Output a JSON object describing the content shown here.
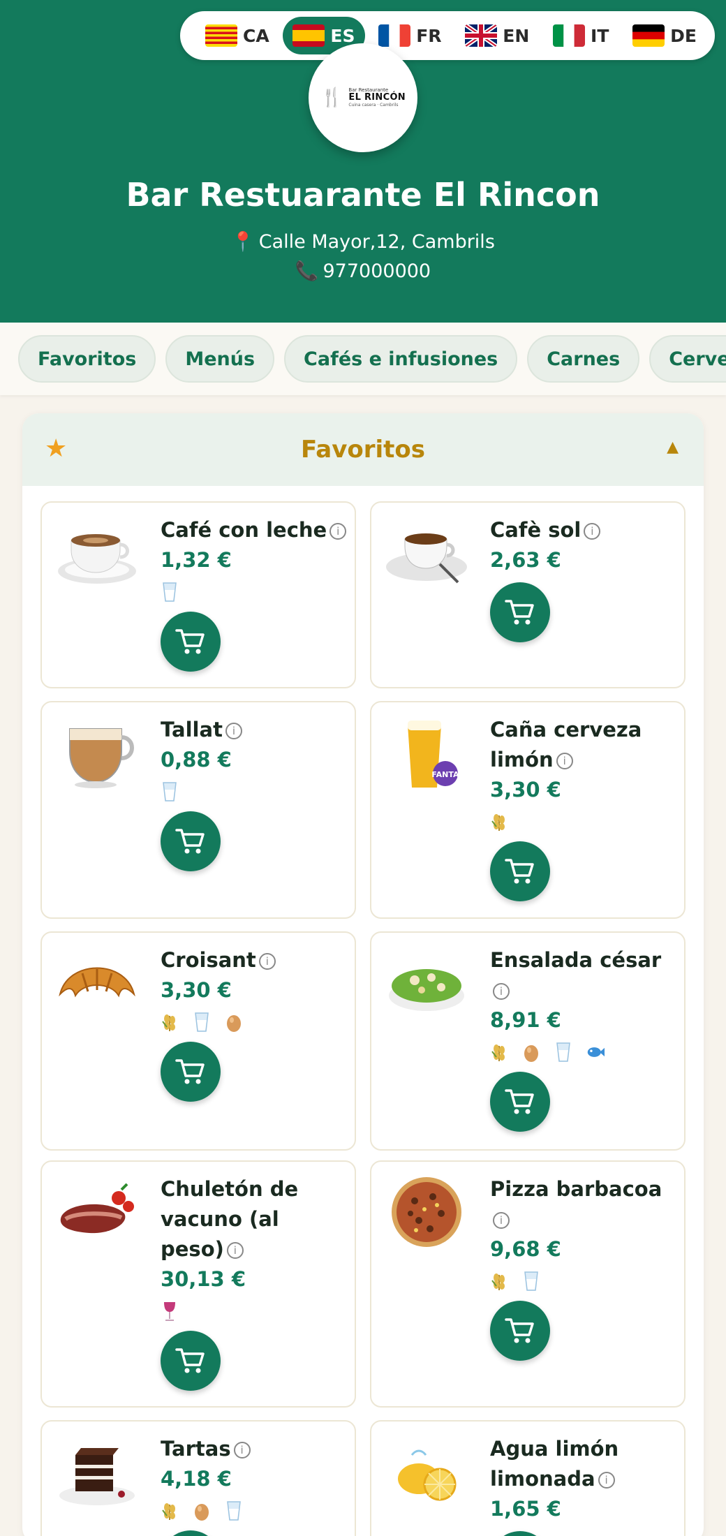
{
  "languages": [
    {
      "code": "CA",
      "flag": "ca-flag-icon",
      "active": false
    },
    {
      "code": "ES",
      "flag": "es-flag-icon",
      "active": true
    },
    {
      "code": "FR",
      "flag": "fr-flag-icon",
      "active": false
    },
    {
      "code": "EN",
      "flag": "uk-flag-icon",
      "active": false
    },
    {
      "code": "IT",
      "flag": "it-flag-icon",
      "active": false
    },
    {
      "code": "DE",
      "flag": "de-flag-icon",
      "active": false
    }
  ],
  "logo": {
    "small": "Bar Restaurante",
    "main": "EL RINCÓN",
    "sub": "Cuina casera · Cambrils"
  },
  "restaurant": {
    "name": "Bar Restuarante El Rincon",
    "address": "Calle Mayor,12, Cambrils",
    "phone": "977000000"
  },
  "categories": [
    "Favoritos",
    "Menús",
    "Cafés e infusiones",
    "Carnes",
    "Cervezas"
  ],
  "section": {
    "title": "Favoritos",
    "star_icon": "star-icon",
    "toggle_icon": "caret-up-icon"
  },
  "products": [
    {
      "name": "Café con leche",
      "price": "1,32 €",
      "image": "coffee-cup-icon",
      "allergens": [
        "milk-icon"
      ]
    },
    {
      "name": "Cafè sol",
      "price": "2,63 €",
      "image": "espresso-cup-icon",
      "allergens": []
    },
    {
      "name": "Tallat",
      "price": "0,88 €",
      "image": "cortado-cup-icon",
      "allergens": [
        "milk-icon"
      ]
    },
    {
      "name": "Caña cerveza limón",
      "price": "3,30 €",
      "image": "beer-glass-icon",
      "allergens": [
        "gluten-icon"
      ]
    },
    {
      "name": "Croisant",
      "price": "3,30 €",
      "image": "croissant-icon",
      "allergens": [
        "gluten-icon",
        "milk-icon",
        "egg-icon"
      ]
    },
    {
      "name": "Ensalada césar",
      "price": "8,91 €",
      "image": "salad-icon",
      "allergens": [
        "gluten-icon",
        "egg-icon",
        "milk-icon",
        "fish-icon"
      ]
    },
    {
      "name": "Chuletón de vacuno (al peso)",
      "price": "30,13 €",
      "image": "steak-icon",
      "allergens": [
        "sulphites-icon"
      ]
    },
    {
      "name": "Pizza barbacoa",
      "price": "9,68 €",
      "image": "pizza-icon",
      "allergens": [
        "gluten-icon",
        "milk-icon"
      ]
    },
    {
      "name": "Tartas",
      "price": "4,18 €",
      "image": "cake-icon",
      "allergens": [
        "gluten-icon",
        "egg-icon",
        "milk-icon"
      ]
    },
    {
      "name": "Agua limón limonada",
      "price": "1,65 €",
      "image": "lemon-icon",
      "allergens": []
    }
  ],
  "colors": {
    "brand": "#137a5c",
    "accent": "#b8860b",
    "star": "#f0a020"
  }
}
